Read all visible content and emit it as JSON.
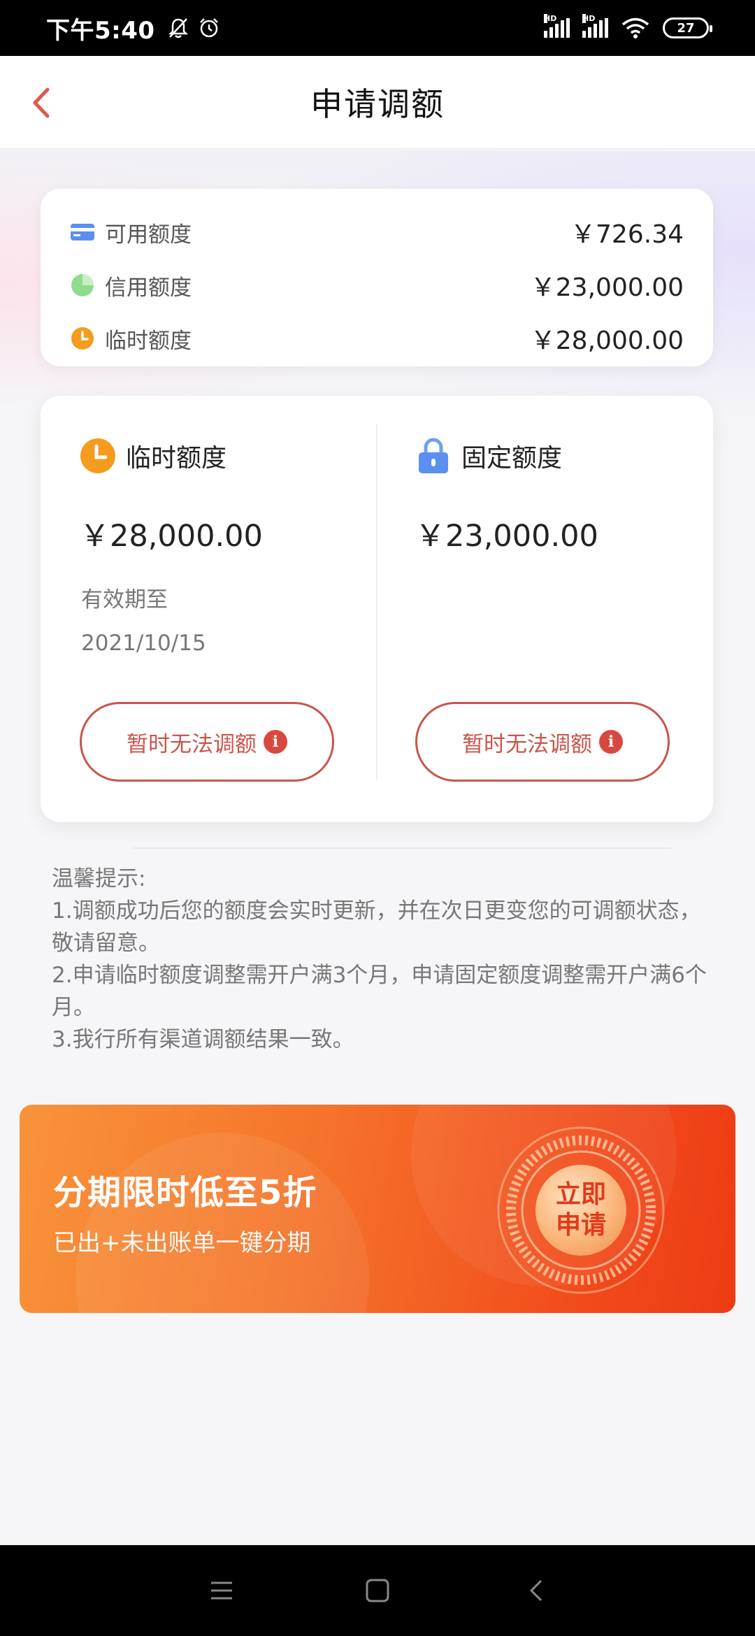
{
  "status_bar": {
    "time": "下午5:40",
    "icons": [
      "bell-off-icon",
      "alarm-icon"
    ],
    "signal_labels": [
      "HD",
      "HD"
    ],
    "battery": "27"
  },
  "header": {
    "title": "申请调额",
    "back_icon": "chevron-left-icon",
    "accent": "#e0584b"
  },
  "summary": {
    "rows": [
      {
        "icon": "card-icon",
        "label": "可用额度",
        "value": "￥726.34"
      },
      {
        "icon": "pie-icon",
        "label": "信用额度",
        "value": "￥23,000.00"
      },
      {
        "icon": "clock-icon",
        "label": "临时额度",
        "value": "￥28,000.00"
      }
    ]
  },
  "limits": {
    "temporary": {
      "icon": "clock-icon",
      "title": "临时额度",
      "amount": "￥28,000.00",
      "expiry_label": "有效期至",
      "expiry_date": "2021/10/15",
      "button_label": "暂时无法调额"
    },
    "fixed": {
      "icon": "lock-icon",
      "title": "固定额度",
      "amount": "￥23,000.00",
      "button_label": "暂时无法调额"
    },
    "info_glyph": "i"
  },
  "tips": {
    "heading": "温馨提示:",
    "lines": [
      "1.调额成功后您的额度会实时更新，并在次日更变您的可调额状态，敬请留意。",
      "2.申请临时额度调整需开户满3个月，申请固定额度调整需开户满6个月。",
      "3.我行所有渠道调额结果一致。"
    ]
  },
  "banner": {
    "title": "分期限时低至5折",
    "subtitle": "已出+未出账单一键分期",
    "cta_line1": "立即",
    "cta_line2": "申请"
  },
  "nav_bar": {
    "icons": [
      "menu-icon",
      "home-square-icon",
      "back-triangle-icon"
    ]
  }
}
